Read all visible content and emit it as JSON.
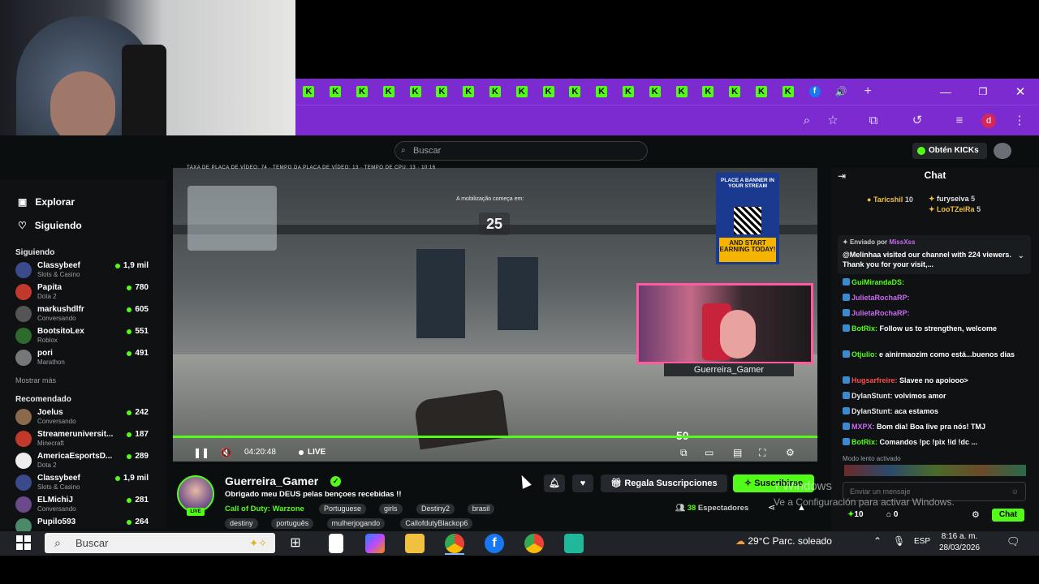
{
  "browser": {
    "tab_icon": "K",
    "tab_count": 19,
    "new_tab": "+",
    "avatar_letter": "d"
  },
  "header": {
    "search_placeholder": "Buscar",
    "kicks_button": "Obtén KICKs"
  },
  "sidebar": {
    "nav": [
      {
        "label": "Explorar",
        "icon": "compass-icon"
      },
      {
        "label": "Siguiendo",
        "icon": "heart-icon"
      }
    ],
    "following_title": "Siguiendo",
    "following": [
      {
        "name": "Classybeef",
        "category": "Slots & Casino",
        "viewers": "1,9 mil",
        "color": "#3a4a8a"
      },
      {
        "name": "Papita",
        "category": "Dota 2",
        "viewers": "780",
        "color": "#c0392b"
      },
      {
        "name": "markushdlfr",
        "category": "Conversando",
        "viewers": "605",
        "color": "#555"
      },
      {
        "name": "BootsitoLex",
        "category": "Roblox",
        "viewers": "551",
        "color": "#2d6a2d"
      },
      {
        "name": "pori",
        "category": "Marathon",
        "viewers": "491",
        "color": "#777"
      }
    ],
    "show_more": "Mostrar más",
    "recommended_title": "Recomendado",
    "recommended": [
      {
        "name": "Joelus",
        "category": "Conversando",
        "viewers": "242",
        "color": "#8a6a4a"
      },
      {
        "name": "Streameruniversit...",
        "category": "Minecraft",
        "viewers": "187",
        "color": "#c0392b"
      },
      {
        "name": "AmericaEsportsD...",
        "category": "Dota 2",
        "viewers": "289",
        "color": "#eee"
      },
      {
        "name": "Classybeef",
        "category": "Slots & Casino",
        "viewers": "1,9 mil",
        "color": "#3a4a8a"
      },
      {
        "name": "ELMichiJ",
        "category": "Conversando",
        "viewers": "281",
        "color": "#6a4a8a"
      },
      {
        "name": "Pupilo593",
        "category": "",
        "viewers": "264",
        "color": "#4a8a6a"
      }
    ]
  },
  "video": {
    "countdown": "25",
    "mobilize_text": "A mobilização começa em:",
    "hud_top": "TAXA DE PLACA DE VÍDEO: 74 · TEMPO DA PLACA DE VÍDEO: 13 · TEMPO DE CPU: 13 · 10:16",
    "banner_top": "PLACE A BANNER IN YOUR STREAM",
    "banner_bottom": "AND START EARNING TODAY!",
    "facecam_name": "Guerreira_Gamer",
    "ammo": "50",
    "time": "04:20:48",
    "live_label": "LIVE"
  },
  "stream": {
    "name": "Guerreira_Gamer",
    "title": "Obrigado meu DEUS pelas bençoes recebidas !!",
    "category": "Call of Duty: Warzone",
    "tags_row1": [
      "Portuguese",
      "girls",
      "Destiny2",
      "brasil"
    ],
    "tags_row2": [
      "destiny",
      "português",
      "mulherjogando",
      "CallofdutyBlackop6"
    ],
    "gift_button": "Regala Suscripciones",
    "subscribe_button": "Suscribirse",
    "viewers_count": "38",
    "viewers_label": "Espectadores",
    "live_badge": "LIVE"
  },
  "chat": {
    "title": "Chat",
    "top_gifters": [
      {
        "name": "Taricshil",
        "count": "10"
      },
      {
        "name": "furyseiva",
        "count": "5"
      },
      {
        "name": "LooTZeiRa",
        "count": "5"
      }
    ],
    "pinned_by_label": "Enviado por",
    "pinned_by_user": "MissXss",
    "pinned_text": "@Melinhaa visited our channel with 224 viewers. Thank you for your visit,...",
    "messages": [
      {
        "user": "GuiMirandaDS:",
        "text": "",
        "color": "#53fc18"
      },
      {
        "user": "JulietaRochaRP:",
        "text": "",
        "color": "#c86af0"
      },
      {
        "user": "JulietaRochaRP:",
        "text": "",
        "color": "#c86af0"
      },
      {
        "user": "BotRix:",
        "text": "Follow us to strengthen, welcome",
        "color": "#53fc18"
      },
      {
        "user": "Otjulio:",
        "text": "e ainirmaozim como está...buenos dias",
        "color": "#53fc18"
      },
      {
        "user": "Hugsarfreire:",
        "text": "Slavee no apoiooo>",
        "color": "#ff4d4d"
      },
      {
        "user": "DylanStunt:",
        "text": "volvimos amor",
        "color": "#e8e8e8"
      },
      {
        "user": "DylanStunt:",
        "text": "aca estamos",
        "color": "#e8e8e8"
      },
      {
        "user": "MXPX:",
        "text": "Bom dia! Boa live pra nós! TMJ",
        "color": "#c86af0"
      },
      {
        "user": "BotRix:",
        "text": "Comandos !pc !pix !id !dc ...",
        "color": "#53fc18"
      }
    ],
    "slow_mode": "Modo lento activado",
    "input_placeholder": "Enviar un mensaje",
    "points": "10",
    "redeem": "0",
    "send_button": "Chat"
  },
  "windows_watermark": {
    "line1": "r Windows",
    "line2": "Ve a Configuración para activar Windows."
  },
  "taskbar": {
    "search": "Buscar",
    "weather": "29°C  Parc. soleado",
    "lang": "ESP",
    "time": "8:16 a. m.",
    "date": "28/03/2026"
  },
  "colors": {
    "kick_green": "#53fc18",
    "browser_purple": "#7b2bd0",
    "page_bg": "#0b0e0f"
  }
}
